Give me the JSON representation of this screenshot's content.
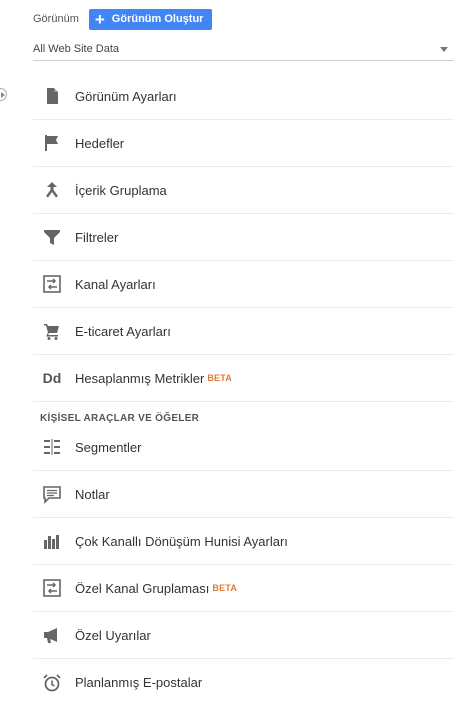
{
  "header": {
    "label": "Görünüm",
    "create_button": "Görünüm Oluştur"
  },
  "view_select": {
    "value": "All Web Site Data"
  },
  "view_menu": [
    {
      "label": "Görünüm Ayarları",
      "icon": "document-icon"
    },
    {
      "label": "Hedefler",
      "icon": "flag-icon"
    },
    {
      "label": "İçerik Gruplama",
      "icon": "merge-icon"
    },
    {
      "label": "Filtreler",
      "icon": "filter-icon"
    },
    {
      "label": "Kanal Ayarları",
      "icon": "channel-icon"
    },
    {
      "label": "E-ticaret Ayarları",
      "icon": "cart-icon"
    },
    {
      "label": "Hesaplanmış Metrikler",
      "icon": "dd-icon",
      "badge": "BETA"
    }
  ],
  "personal_section": {
    "title": "KİŞİSEL ARAÇLAR VE ÖĞELER",
    "items": [
      {
        "label": "Segmentler",
        "icon": "segments-icon"
      },
      {
        "label": "Notlar",
        "icon": "comment-icon"
      },
      {
        "label": "Çok Kanallı Dönüşüm Hunisi Ayarları",
        "icon": "bar-chart-icon"
      },
      {
        "label": "Özel Kanal Gruplaması",
        "icon": "channel-icon",
        "badge": "BETA"
      },
      {
        "label": "Özel Uyarılar",
        "icon": "megaphone-icon"
      },
      {
        "label": "Planlanmış E-postalar",
        "icon": "alarm-clock-icon"
      }
    ]
  }
}
